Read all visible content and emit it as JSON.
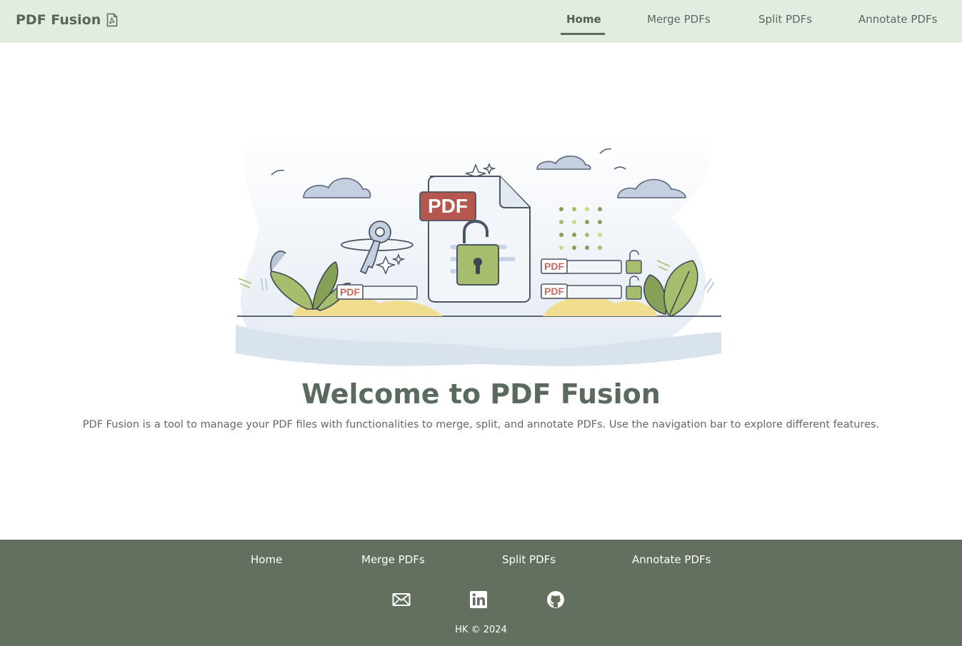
{
  "app": {
    "brand": "PDF Fusion",
    "brand_icon": "pdf-file-icon"
  },
  "nav": {
    "items": [
      {
        "label": "Home",
        "active": true
      },
      {
        "label": "Merge PDFs",
        "active": false
      },
      {
        "label": "Split PDFs",
        "active": false
      },
      {
        "label": "Annotate PDFs",
        "active": false
      }
    ]
  },
  "hero": {
    "illustration": "pdf-lock-illustration",
    "badge_text": "PDF",
    "small_badge_text": "PDF"
  },
  "main": {
    "title": "Welcome to PDF Fusion",
    "description": "PDF Fusion is a tool to manage your PDF files with functionalities to merge, split, and annotate PDFs. Use the navigation bar to explore different features."
  },
  "footer": {
    "links": [
      "Home",
      "Merge PDFs",
      "Split PDFs",
      "Annotate PDFs"
    ],
    "icons": [
      "mail-icon",
      "linkedin-icon",
      "github-icon"
    ],
    "copyright": "HK © 2024"
  },
  "colors": {
    "navbar_bg": "#e2ece0",
    "footer_bg": "#637060",
    "text_primary": "#5a6a5e",
    "pdf_badge": "#b5574f",
    "lock_green": "#a6bd6e"
  }
}
